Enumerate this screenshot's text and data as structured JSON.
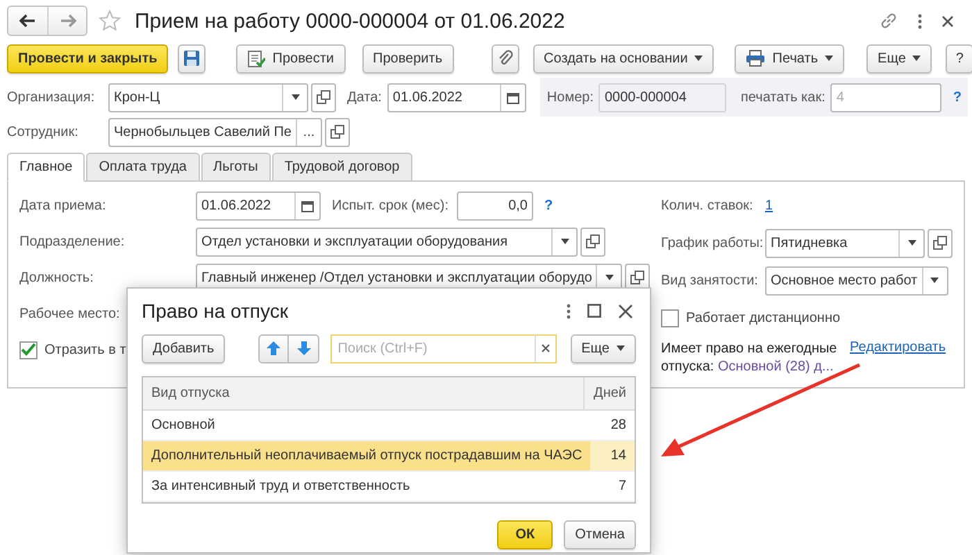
{
  "window": {
    "title": "Прием на работу 0000-000004 от 01.06.2022"
  },
  "toolbar": [
    {
      "kind": "primary",
      "label": "Провести и закрыть"
    },
    {
      "kind": "save"
    },
    {
      "kind": "post",
      "label": "Провести"
    },
    {
      "kind": "plain",
      "label": "Проверить"
    },
    {
      "kind": "attach"
    },
    {
      "kind": "menu",
      "label": "Создать на основании"
    },
    {
      "kind": "print",
      "label": "Печать"
    },
    {
      "kind": "menu",
      "label": "Еще"
    },
    {
      "kind": "plain",
      "label": "?"
    }
  ],
  "header": {
    "organization": {
      "label": "Организация:",
      "value": "Крон-Ц"
    },
    "date": {
      "label": "Дата:",
      "value": "01.06.2022"
    },
    "number": {
      "label": "Номер:",
      "value": "0000-000004"
    },
    "print_as": {
      "label": "печатать как:",
      "placeholder": "4",
      "help": "?"
    },
    "employee": {
      "label": "Сотрудник:",
      "value": "Чернобыльцев Савелий Пе",
      "button": "..."
    }
  },
  "tabs": [
    {
      "label": "Главное",
      "selected": true
    },
    {
      "label": "Оплата труда",
      "selected": false
    },
    {
      "label": "Льготы",
      "selected": false
    },
    {
      "label": "Трудовой договор",
      "selected": false
    }
  ],
  "main": {
    "hire_date": {
      "label": "Дата приема:",
      "value": "01.06.2022"
    },
    "probation": {
      "label": "Испыт. срок (мес):",
      "value": "0,0",
      "help": "?"
    },
    "department": {
      "label": "Подразделение:",
      "value": "Отдел установки и эксплуатации оборудования"
    },
    "position": {
      "label": "Должность:",
      "value": "Главный инженер /Отдел установки и эксплуатации оборудо"
    },
    "workplace": {
      "label": "Рабочее место:"
    },
    "reflect": {
      "label": "Отразить в т",
      "checked": true
    }
  },
  "side": {
    "rates": {
      "label": "Колич. ставок:",
      "value": "1"
    },
    "schedule": {
      "label": "График работы:",
      "value": "Пятидневка"
    },
    "employment": {
      "label": "Вид занятости:",
      "value": "Основное место работ"
    },
    "remote": {
      "label": "Работает дистанционно",
      "checked": false
    },
    "vacation": {
      "label": "Имеет право на ежегодные отпуска:",
      "value": "Основной (28) д...",
      "edit": "Редактировать"
    }
  },
  "dialog": {
    "title": "Право на отпуск",
    "add": "Добавить",
    "search_placeholder": "Поиск (Ctrl+F)",
    "more": "Еще",
    "columns": [
      "Вид отпуска",
      "Дней"
    ],
    "rows": [
      {
        "type": "Основной",
        "days": "28",
        "selected": false
      },
      {
        "type": "Дополнительный неоплачиваемый отпуск пострадавшим на ЧАЭС",
        "days": "14",
        "selected": true
      },
      {
        "type": "За интенсивный труд и ответственность",
        "days": "7",
        "selected": false
      }
    ],
    "ok": "ОК",
    "cancel": "Отмена"
  }
}
